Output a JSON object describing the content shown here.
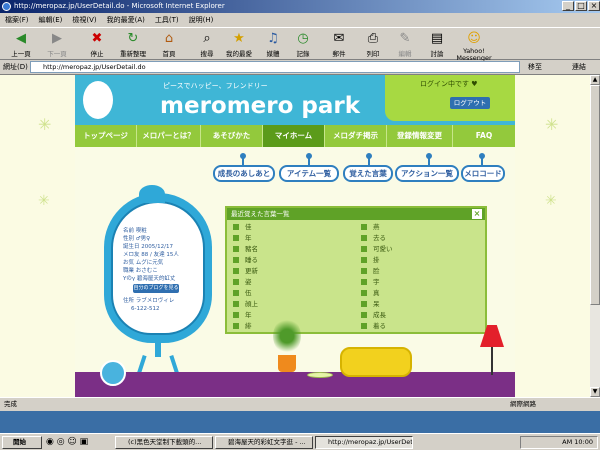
{
  "window": {
    "title": "http://meropaz.jp/UserDetail.do - Microsoft Internet Explorer"
  },
  "menu": [
    "檔案(F)",
    "編輯(E)",
    "檢視(V)",
    "我的最愛(A)",
    "工具(T)",
    "說明(H)"
  ],
  "toolbar": [
    {
      "label": "上一頁",
      "icon": "back-icon"
    },
    {
      "label": "下一頁",
      "icon": "forward-icon"
    },
    {
      "label": "停止",
      "icon": "stop-icon"
    },
    {
      "label": "重新整理",
      "icon": "refresh-icon"
    },
    {
      "label": "首頁",
      "icon": "home-icon"
    },
    {
      "label": "搜尋",
      "icon": "search-icon"
    },
    {
      "label": "我的最愛",
      "icon": "favorites-icon"
    },
    {
      "label": "媒體",
      "icon": "media-icon"
    },
    {
      "label": "記錄",
      "icon": "history-icon"
    },
    {
      "label": "郵件",
      "icon": "mail-icon"
    },
    {
      "label": "列印",
      "icon": "print-icon"
    },
    {
      "label": "編輯",
      "icon": "edit-icon"
    },
    {
      "label": "討論",
      "icon": "discuss-icon"
    },
    {
      "label": "Yahoo! Messenger",
      "icon": "messenger-icon"
    }
  ],
  "address": {
    "label": "網址(D)",
    "url": "http://meropaz.jp/UserDetail.do",
    "go": "移至",
    "links": "連結"
  },
  "site": {
    "tagline": "ピースでハッピー、フレンドリー",
    "logo": "meromero park",
    "login_msg": "ログイン中です ♥",
    "logout": "ログアウト",
    "nav": [
      "トップページ",
      "メロパーとは？",
      "あそびかた",
      "マイホーム",
      "メロダチ掲示",
      "登録情報変更",
      "FAQ"
    ],
    "active_nav": 3,
    "pills": [
      "成長のあしあと",
      "アイテム一覧",
      "覚えた言葉",
      "アクション一覧",
      "メロコード"
    ],
    "panel_title": "最近覚えた言葉一覧",
    "words_left": [
      "佳",
      "年",
      "豬名",
      "睡る",
      "更新",
      "姿",
      "伍",
      "顔上",
      "年",
      "緋"
    ],
    "words_right": [
      "燕",
      "去る",
      "可愛い",
      "掛",
      "脸",
      "宇",
      "真",
      "呆",
      "成長",
      "着る"
    ],
    "profile": [
      "名前  喫粧",
      "性別  ♂男♀",
      "誕生日  2005/12/17",
      "メロ友 88 / 友達 15人",
      "お気 ムグに元気",
      "職業 おさむこ",
      "Yのγ 碧海屋天的虹丈",
      "住所 ラブメロヴィレ",
      "6-122-512"
    ],
    "blog_btn": "自分のブログを見る"
  },
  "status": {
    "text": "完成",
    "zone": "網際網路"
  },
  "taskbar": {
    "start": "開始",
    "items": [
      "(c)黑色天堂制下載頭的...",
      "碧海屋天的彩虹文字逛 - ...",
      "http://meropaz.jp/UserDetail..."
    ],
    "clock": "AM 10:00"
  }
}
